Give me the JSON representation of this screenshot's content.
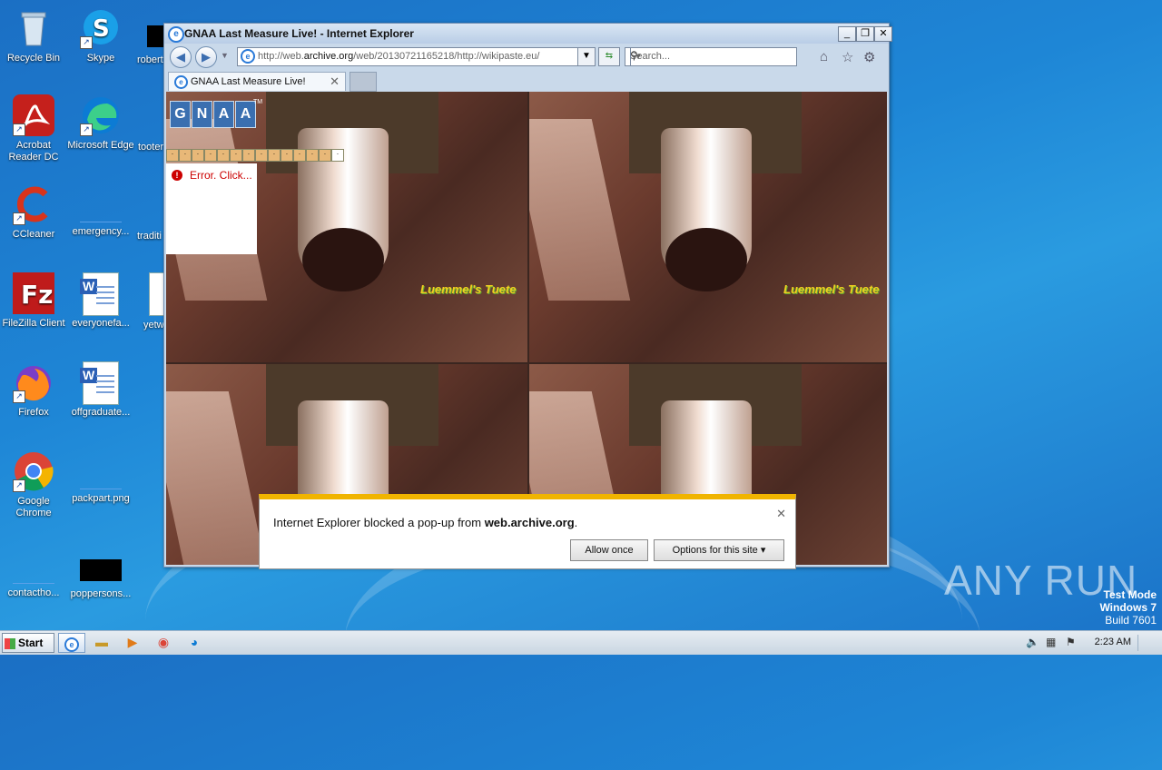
{
  "desktop": {
    "icons": [
      {
        "label": "Recycle Bin",
        "icon": "recycle-bin-icon"
      },
      {
        "label": "Skype",
        "icon": "skype-icon"
      },
      {
        "label": "robert",
        "icon": "black-file-icon"
      },
      {
        "label": "Acrobat Reader DC",
        "icon": "acrobat-icon"
      },
      {
        "label": "Microsoft Edge",
        "icon": "edge-icon"
      },
      {
        "label": "tooter",
        "icon": "file-icon"
      },
      {
        "label": "CCleaner",
        "icon": "ccleaner-icon"
      },
      {
        "label": "emergency...",
        "icon": "file-icon"
      },
      {
        "label": "traditi",
        "icon": "file-icon"
      },
      {
        "label": "FileZilla Client",
        "icon": "filezilla-icon"
      },
      {
        "label": "everyonefa...",
        "icon": "word-doc-icon"
      },
      {
        "label": "yetw",
        "icon": "word-doc-icon"
      },
      {
        "label": "Firefox",
        "icon": "firefox-icon"
      },
      {
        "label": "offgraduate...",
        "icon": "word-doc-icon"
      },
      {
        "label": "Google Chrome",
        "icon": "chrome-icon"
      },
      {
        "label": "packpart.png",
        "icon": "png-file-icon"
      },
      {
        "label": "contactho...",
        "icon": "file-icon"
      },
      {
        "label": "poppersons...",
        "icon": "black-file-icon"
      }
    ]
  },
  "ie": {
    "window_title": "GNAA Last Measure Live! - Internet Explorer",
    "url_prefix": "http://web.",
    "url_domain": "archive.org",
    "url_rest": "/web/20130721165218/http://wikipaste.eu/",
    "search_placeholder": "Search...",
    "tab_title": "GNAA Last Measure Live!",
    "page": {
      "logo_letters": [
        "G",
        "N",
        "A",
        "A"
      ],
      "logo_tm": "TM",
      "error_text": "Error. Click...",
      "stamp_text": "Luemmel's Tuete"
    }
  },
  "popup": {
    "message_prefix": "Internet Explorer blocked a pop-up from ",
    "message_domain": "web.archive.org",
    "message_suffix": ".",
    "allow_once": "Allow once",
    "options": "Options for this site"
  },
  "watermark": {
    "brand": "ANY RUN",
    "test_mode": "Test Mode",
    "os": "Windows 7",
    "build": "Build 7601"
  },
  "taskbar": {
    "start_label": "Start",
    "clock": "2:23 AM"
  }
}
